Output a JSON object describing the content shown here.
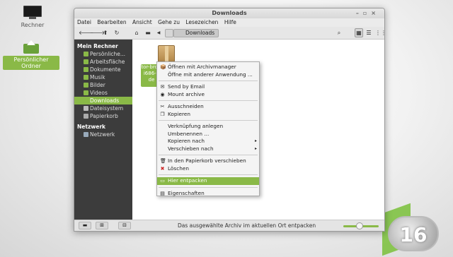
{
  "desktop": {
    "computer_label": "Rechner",
    "home_label": "Persönlicher Ordner",
    "version_badge": "16"
  },
  "window": {
    "title": "Downloads",
    "controls": [
      "–",
      "▫",
      "×"
    ],
    "menu": [
      "Datei",
      "Bearbeiten",
      "Ansicht",
      "Gehe zu",
      "Lesezeichen",
      "Hilfe"
    ],
    "toolbar": {
      "back": "🡐",
      "forward": "🡒",
      "up": "⬆",
      "reload": "↻",
      "home": "⌂",
      "computer": "▬",
      "prev": "◀",
      "location": "Downloads",
      "search": "⌕",
      "view_icons": "▦",
      "view_list": "☰",
      "view_compact": "⋮⋮"
    },
    "sidebar": {
      "computer_head": "Mein Rechner",
      "items": [
        {
          "label": "Persönliche...",
          "active": false
        },
        {
          "label": "Arbeitsfläche",
          "active": false
        },
        {
          "label": "Dokumente",
          "active": false
        },
        {
          "label": "Musik",
          "active": false
        },
        {
          "label": "Bilder",
          "active": false
        },
        {
          "label": "Videos",
          "active": false
        },
        {
          "label": "Downloads",
          "active": true
        },
        {
          "label": "Dateisystem",
          "active": false
        },
        {
          "label": "Papierkorb",
          "active": false
        }
      ],
      "network_head": "Netzwerk",
      "network_items": [
        {
          "label": "Netzwerk"
        }
      ]
    },
    "file": {
      "name_line1": "tor-brow",
      "name_line2": "i686-2",
      "name_line3": "de"
    },
    "statusbar": {
      "text": "Das ausgewählte Archiv im aktuellen Ort entpacken",
      "buttons": [
        "▬",
        "⊞",
        "⊟"
      ],
      "zoom_fraction": 0.45
    }
  },
  "context_menu": {
    "items": [
      {
        "label": "Öffnen mit Archivmanager",
        "icon": "📦",
        "sub": false,
        "highlight": false
      },
      {
        "label": "Öffne mit anderer Anwendung ...",
        "icon": "",
        "sub": false,
        "highlight": false
      },
      {
        "sep": true
      },
      {
        "label": "Send by Email",
        "icon": "✉",
        "sub": false,
        "highlight": false
      },
      {
        "label": "Mount archive",
        "icon": "◉",
        "sub": false,
        "highlight": false
      },
      {
        "sep": true
      },
      {
        "label": "Ausschneiden",
        "icon": "✂",
        "sub": false,
        "highlight": false
      },
      {
        "label": "Kopieren",
        "icon": "❐",
        "sub": false,
        "highlight": false
      },
      {
        "sep": true
      },
      {
        "label": "Verknüpfung anlegen",
        "icon": "",
        "sub": false,
        "highlight": false
      },
      {
        "label": "Umbenennen ...",
        "icon": "",
        "sub": false,
        "highlight": false
      },
      {
        "label": "Kopieren nach",
        "icon": "",
        "sub": true,
        "highlight": false
      },
      {
        "label": "Verschieben nach",
        "icon": "",
        "sub": true,
        "highlight": false
      },
      {
        "sep": true
      },
      {
        "label": "In den Papierkorb verschieben",
        "icon": "🗑",
        "sub": false,
        "highlight": false
      },
      {
        "label": "Löschen",
        "icon": "✖",
        "sub": false,
        "highlight": false
      },
      {
        "sep": true
      },
      {
        "label": "Hier entpacken",
        "icon": "▭",
        "sub": false,
        "highlight": true
      },
      {
        "sep": true
      },
      {
        "label": "Eigenschaften",
        "icon": "▤",
        "sub": false,
        "highlight": false
      }
    ]
  },
  "colors": {
    "accent": "#8ab947",
    "sidebar_bg": "#3c3c3c",
    "delete_icon": "#cc2222"
  }
}
